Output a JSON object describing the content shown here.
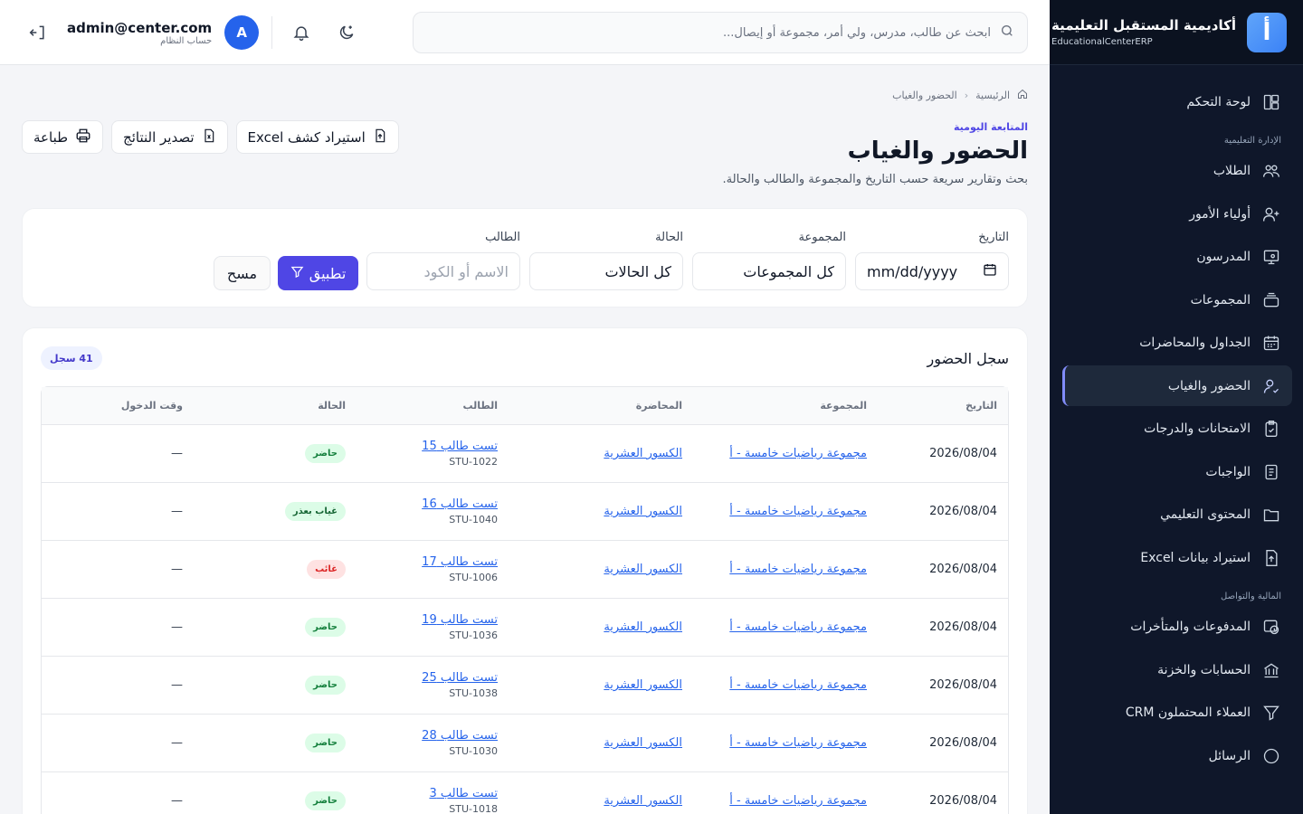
{
  "brand": {
    "title": "أكاديمية المستقبل التعليمية",
    "subtitle": "EducationalCenterERP",
    "logo_letter": "أ"
  },
  "sidebar": {
    "items": [
      {
        "label": "لوحة التحكم",
        "icon": "dashboard-icon"
      },
      {
        "section": "الإدارة التعليمية"
      },
      {
        "label": "الطلاب",
        "icon": "students-icon"
      },
      {
        "label": "أولياء الأمور",
        "icon": "parents-icon"
      },
      {
        "label": "المدرسون",
        "icon": "teachers-icon"
      },
      {
        "label": "المجموعات",
        "icon": "groups-icon"
      },
      {
        "label": "الجداول والمحاضرات",
        "icon": "calendar-icon"
      },
      {
        "label": "الحضور والغياب",
        "icon": "attendance-icon",
        "active": true
      },
      {
        "label": "الامتحانات والدرجات",
        "icon": "exams-icon"
      },
      {
        "label": "الواجبات",
        "icon": "homework-icon"
      },
      {
        "label": "المحتوى التعليمي",
        "icon": "folder-icon"
      },
      {
        "label": "استيراد بيانات Excel",
        "icon": "import-icon"
      },
      {
        "section": "المالية والتواصل"
      },
      {
        "label": "المدفوعات والمتأخرات",
        "icon": "payments-icon"
      },
      {
        "label": "الحسابات والخزنة",
        "icon": "bank-icon"
      },
      {
        "label": "العملاء المحتملون CRM",
        "icon": "funnel-icon"
      },
      {
        "label": "الرسائل",
        "icon": "chat-icon"
      }
    ]
  },
  "topbar": {
    "search_placeholder": "ابحث عن طالب، مدرس، ولي أمر، مجموعة أو إيصال...",
    "user_email": "admin@center.com",
    "user_role": "حساب النظام",
    "avatar_letter": "A"
  },
  "page": {
    "breadcrumb_home": "الرئيسية",
    "breadcrumb_current": "الحضور والغياب",
    "eyebrow": "المتابعة اليومية",
    "title": "الحضور والغياب",
    "description": "بحث وتقارير سريعة حسب التاريخ والمجموعة والطالب والحالة.",
    "actions": {
      "import": "استيراد كشف Excel",
      "export": "تصدير النتائج",
      "print": "طباعة"
    }
  },
  "filters": {
    "date_label": "التاريخ",
    "date_value": "mm/dd/yyyy",
    "group_label": "المجموعة",
    "group_value": "كل المجموعات",
    "status_label": "الحالة",
    "status_value": "كل الحالات",
    "student_label": "الطالب",
    "student_placeholder": "الاسم أو الكود",
    "apply": "تطبيق",
    "clear": "مسح"
  },
  "records": {
    "title": "سجل الحضور",
    "count": "41 سجل",
    "columns": [
      "التاريخ",
      "المجموعة",
      "المحاضرة",
      "الطالب",
      "الحالة",
      "وقت الدخول"
    ],
    "rows": [
      {
        "date": "2026/08/04",
        "group": "مجموعة رياضيات خامسة - أ",
        "lecture": "الكسور العشرية",
        "student": "تست طالب 15",
        "code": "STU-1022",
        "status": "حاضر",
        "status_type": "present",
        "time": "—"
      },
      {
        "date": "2026/08/04",
        "group": "مجموعة رياضيات خامسة - أ",
        "lecture": "الكسور العشرية",
        "student": "تست طالب 16",
        "code": "STU-1040",
        "status": "غياب بعذر",
        "status_type": "excused",
        "time": "—"
      },
      {
        "date": "2026/08/04",
        "group": "مجموعة رياضيات خامسة - أ",
        "lecture": "الكسور العشرية",
        "student": "تست طالب 17",
        "code": "STU-1006",
        "status": "غائب",
        "status_type": "absent",
        "time": "—"
      },
      {
        "date": "2026/08/04",
        "group": "مجموعة رياضيات خامسة - أ",
        "lecture": "الكسور العشرية",
        "student": "تست طالب 19",
        "code": "STU-1036",
        "status": "حاضر",
        "status_type": "present",
        "time": "—"
      },
      {
        "date": "2026/08/04",
        "group": "مجموعة رياضيات خامسة - أ",
        "lecture": "الكسور العشرية",
        "student": "تست طالب 25",
        "code": "STU-1038",
        "status": "حاضر",
        "status_type": "present",
        "time": "—"
      },
      {
        "date": "2026/08/04",
        "group": "مجموعة رياضيات خامسة - أ",
        "lecture": "الكسور العشرية",
        "student": "تست طالب 28",
        "code": "STU-1030",
        "status": "حاضر",
        "status_type": "present",
        "time": "—"
      },
      {
        "date": "2026/08/04",
        "group": "مجموعة رياضيات خامسة - أ",
        "lecture": "الكسور العشرية",
        "student": "تست طالب 3",
        "code": "STU-1018",
        "status": "حاضر",
        "status_type": "present",
        "time": "—"
      }
    ]
  }
}
